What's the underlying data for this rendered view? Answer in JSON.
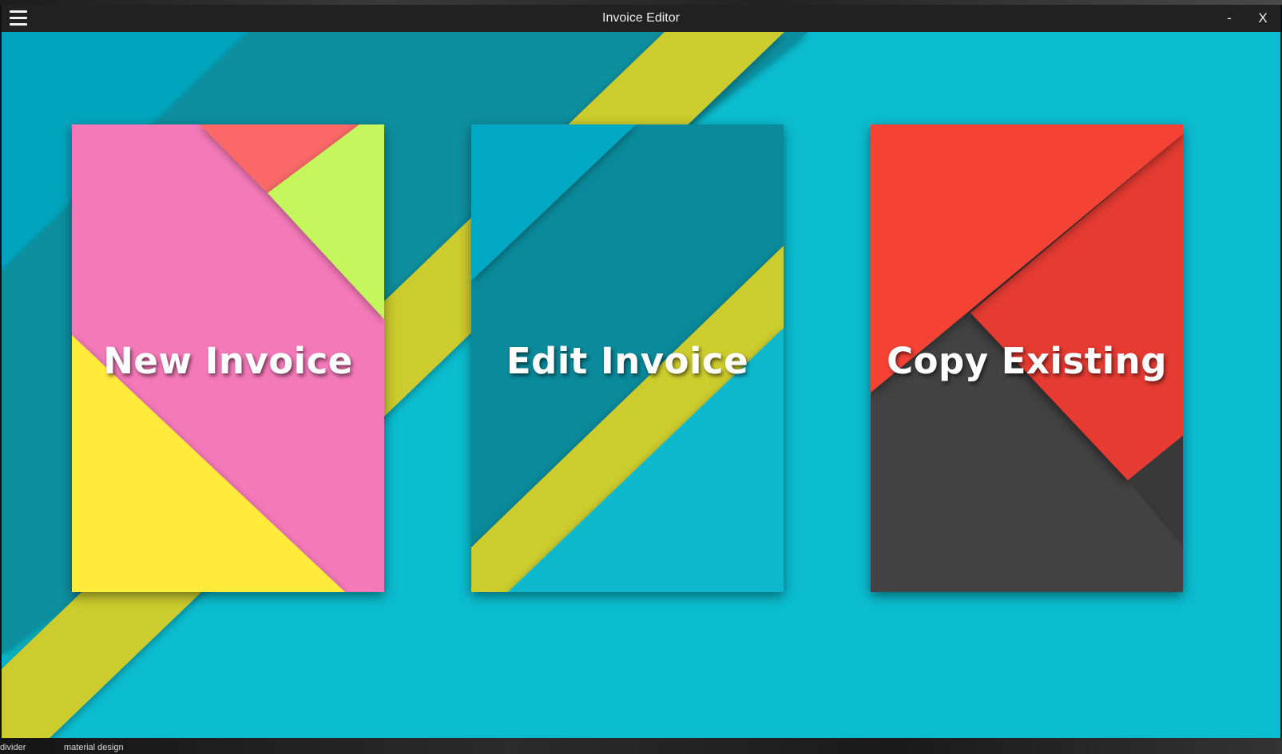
{
  "window": {
    "title": "Invoice Editor",
    "minimize_label": "-",
    "close_label": "X"
  },
  "menu_icon": "hamburger-menu-icon",
  "tiles": [
    {
      "label": "New Invoice",
      "colors": [
        "#f479b8",
        "#ffeb3b",
        "#fa6868",
        "#c6f65d"
      ]
    },
    {
      "label": "Edit Invoice",
      "colors": [
        "#0a8a9b",
        "#00a8c3",
        "#cccc2f",
        "#0cb8cd"
      ]
    },
    {
      "label": "Copy Existing",
      "colors": [
        "#f44336",
        "#424242",
        "#e53a30"
      ]
    }
  ],
  "desktop": {
    "taskbar_labels": [
      "divider",
      "material design"
    ]
  },
  "colors": {
    "background": "#0bbccf",
    "stripe": "#cccc2f",
    "titlebar": "#212121"
  }
}
